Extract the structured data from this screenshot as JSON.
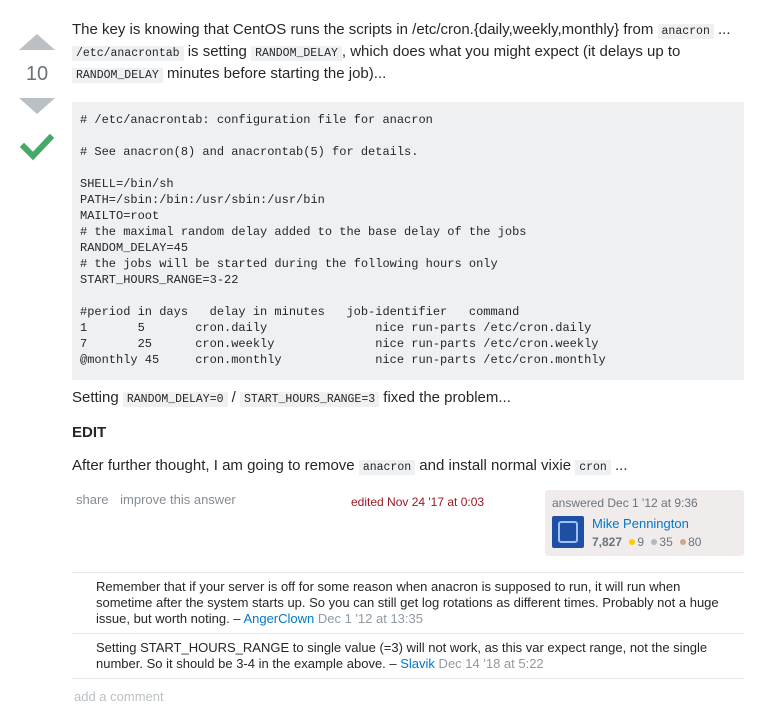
{
  "vote": {
    "count": "10"
  },
  "answer": {
    "p1": {
      "t1": "The key is knowing that CentOS runs the scripts in /etc/cron.{daily,weekly,monthly} from ",
      "c1": "anacron",
      "t2": " ... ",
      "c2": "/etc/anacrontab",
      "t3": " is setting ",
      "c3": "RANDOM_DELAY",
      "t4": ", which does what you might expect (it delays up to ",
      "c4": "RANDOM_DELAY",
      "t5": " minutes before starting the job)..."
    },
    "code": "# /etc/anacrontab: configuration file for anacron\n\n# See anacron(8) and anacrontab(5) for details.\n\nSHELL=/bin/sh\nPATH=/sbin:/bin:/usr/sbin:/usr/bin\nMAILTO=root\n# the maximal random delay added to the base delay of the jobs\nRANDOM_DELAY=45\n# the jobs will be started during the following hours only\nSTART_HOURS_RANGE=3-22\n\n#period in days   delay in minutes   job-identifier   command\n1       5       cron.daily               nice run-parts /etc/cron.daily\n7       25      cron.weekly              nice run-parts /etc/cron.weekly\n@monthly 45     cron.monthly             nice run-parts /etc/cron.monthly",
    "p2": {
      "t1": "Setting ",
      "c1": "RANDOM_DELAY=0",
      "t2": " / ",
      "c2": "START_HOURS_RANGE=3",
      "t3": " fixed the problem..."
    },
    "edit_heading": "EDIT",
    "p3": {
      "t1": "After further thought, I am going to remove ",
      "c1": "anacron",
      "t2": " and install normal vixie ",
      "c2": "cron",
      "t3": " ..."
    }
  },
  "menu": {
    "share": "share",
    "improve": "improve this answer"
  },
  "edited": {
    "label": "edited ",
    "time": "Nov 24 '17 at 0:03"
  },
  "user": {
    "action": "answered Dec 1 '12 at 9:36",
    "name": "Mike Pennington",
    "rep": "7,827",
    "gold": "9",
    "silver": "35",
    "bronze": "80",
    "colors": {
      "gold": "#ffcc01",
      "silver": "#b4b8bc",
      "bronze": "#d1a684"
    }
  },
  "comments": [
    {
      "text": "Remember that if your server is off for some reason when anacron is supposed to run, it will run when sometime after the system starts up. So you can still get log rotations as different times. Probably not a huge issue, but worth noting. – ",
      "user": "AngerClown",
      "date": " Dec 1 '12 at 13:35"
    },
    {
      "text": "Setting START_HOURS_RANGE to single value (=3) will not work, as this var expect range, not the single number. So it should be 3-4 in the example above. – ",
      "user": "Slavik",
      "date": " Dec 14 '18 at 5:22"
    }
  ],
  "add_comment": "add a comment"
}
